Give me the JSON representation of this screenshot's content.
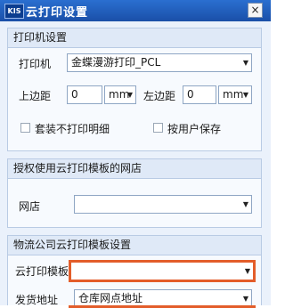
{
  "window": {
    "app_icon": "KIS",
    "title": "云打印设置",
    "close_label": "×"
  },
  "printer_panel": {
    "header": "打印机设置",
    "printer_label": "打印机",
    "printer_value": "金蝶漫游打印_PCL",
    "top_margin_label": "上边距",
    "top_margin_value": "0",
    "top_margin_unit": "mm",
    "left_margin_label": "左边距",
    "left_margin_value": "0",
    "left_margin_unit": "mm",
    "checkbox_set_label": "套装不打印明细",
    "checkbox_user_label": "按用户保存"
  },
  "shop_panel": {
    "header": "授权使用云打印模板的网店",
    "shop_label": "网店",
    "shop_value": ""
  },
  "logistics_panel": {
    "header": "物流公司云打印模板设置",
    "template_label": "云打印模板",
    "template_value": "",
    "ship_addr_label": "发货地址",
    "ship_addr_value": "仓库网点地址"
  },
  "icons": {
    "dropdown": "chevron-down-icon"
  },
  "colors": {
    "highlight": "#e35d2a",
    "titlebar": "#1a4fa8"
  }
}
